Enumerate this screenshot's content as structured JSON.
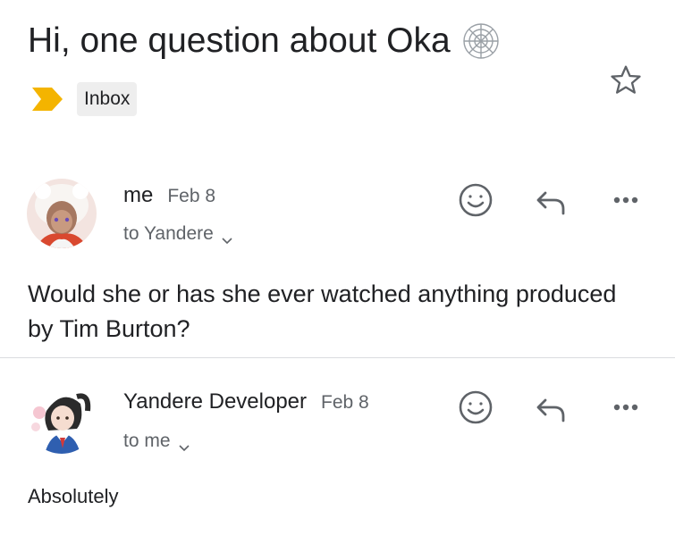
{
  "thread": {
    "subject": "Hi, one question about Oka",
    "subject_emoji_icon": "spider-web-icon",
    "label": "Inbox",
    "star_icon": "star-outline-icon",
    "importance_icon": "importance-marker-icon",
    "importance_color": "#f4b400"
  },
  "messages": [
    {
      "sender": "me",
      "date": "Feb 8",
      "to": "to Yandere",
      "body": "Would she or has she ever watched anything produced by Tim Burton?",
      "avatar": "user-avatar",
      "actions": {
        "react_icon": "emoji-reaction-icon",
        "reply_icon": "reply-icon",
        "more_icon": "more-options-icon"
      }
    },
    {
      "sender": "Yandere Developer",
      "date": "Feb 8",
      "to": "to me",
      "body": "Absolutely",
      "avatar": "sender-avatar",
      "actions": {
        "react_icon": "emoji-reaction-icon",
        "reply_icon": "reply-icon",
        "more_icon": "more-options-icon"
      }
    }
  ],
  "colors": {
    "text_primary": "#202124",
    "text_secondary": "#5f6368",
    "icon_gray": "#5f6368",
    "chip_bg": "#eeeeee",
    "divider": "#dadce0"
  }
}
